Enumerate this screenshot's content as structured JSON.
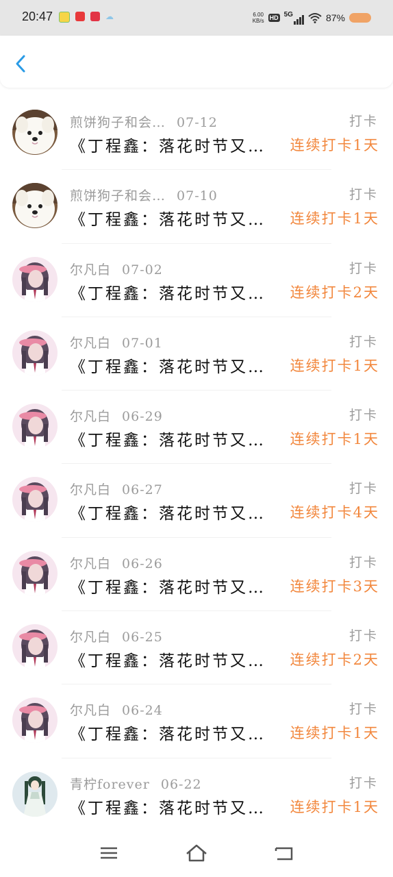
{
  "status_bar": {
    "time": "20:47",
    "net_speed_value": "6.00",
    "net_speed_unit": "KB/s",
    "hd": "HD",
    "signal": "5G",
    "battery": "87%",
    "battery_color": "#f0a366"
  },
  "header": {
    "back_icon": "chevron-left-icon",
    "accent": "#2a9be6"
  },
  "list": {
    "type_label": "打卡",
    "title": "《丁程鑫：落花时节又…",
    "items": [
      {
        "name": "煎饼狗子和会…",
        "date": "07-12",
        "streak": "连续打卡1天",
        "avatar": "samoyed"
      },
      {
        "name": "煎饼狗子和会…",
        "date": "07-10",
        "streak": "连续打卡1天",
        "avatar": "samoyed"
      },
      {
        "name": "尔凡白",
        "date": "07-02",
        "streak": "连续打卡2天",
        "avatar": "girl"
      },
      {
        "name": "尔凡白",
        "date": "07-01",
        "streak": "连续打卡1天",
        "avatar": "girl"
      },
      {
        "name": "尔凡白",
        "date": "06-29",
        "streak": "连续打卡1天",
        "avatar": "girl"
      },
      {
        "name": "尔凡白",
        "date": "06-27",
        "streak": "连续打卡4天",
        "avatar": "girl"
      },
      {
        "name": "尔凡白",
        "date": "06-26",
        "streak": "连续打卡3天",
        "avatar": "girl"
      },
      {
        "name": "尔凡白",
        "date": "06-25",
        "streak": "连续打卡2天",
        "avatar": "girl"
      },
      {
        "name": "尔凡白",
        "date": "06-24",
        "streak": "连续打卡1天",
        "avatar": "girl"
      },
      {
        "name": "青柠forever",
        "date": "06-22",
        "streak": "连续打卡1天",
        "avatar": "anime"
      }
    ],
    "streak_color": "#f2873d"
  },
  "bottom_nav": {
    "icons": [
      "menu-icon",
      "home-icon",
      "back-icon"
    ]
  }
}
